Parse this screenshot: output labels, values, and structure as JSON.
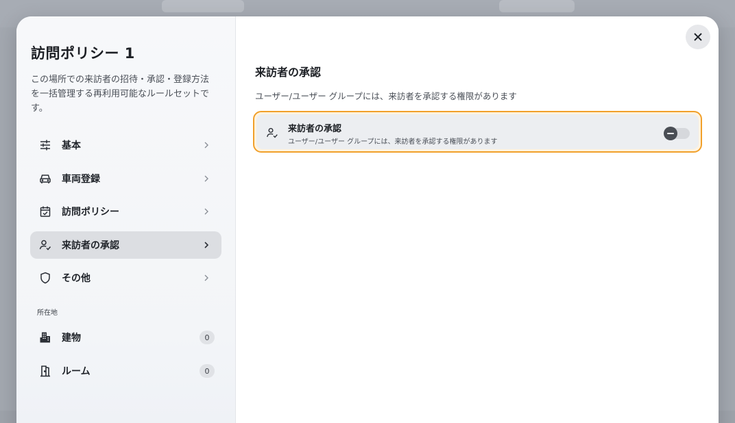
{
  "sidebar": {
    "title": "訪問ポリシー 1",
    "description": "この場所での来訪者の招待・承認・登録方法を一括管理する再利用可能なルールセットです。",
    "items": [
      {
        "label": "基本",
        "icon": "sliders-icon"
      },
      {
        "label": "車両登録",
        "icon": "car-icon"
      },
      {
        "label": "訪問ポリシー",
        "icon": "calendar-check-icon"
      },
      {
        "label": "来訪者の承認",
        "icon": "user-check-icon",
        "active": true
      },
      {
        "label": "その他",
        "icon": "shield-icon"
      }
    ],
    "section_label": "所在地",
    "locations": [
      {
        "label": "建物",
        "count": "0",
        "icon": "building-icon"
      },
      {
        "label": "ルーム",
        "count": "0",
        "icon": "door-icon"
      }
    ]
  },
  "content": {
    "title": "来訪者の承認",
    "description": "ユーザー/ユーザー グループには、来訪者を承認する権限があります",
    "setting": {
      "title": "来訪者の承認",
      "subtitle": "ユーザー/ユーザー グループには、来訪者を承認する権限があります",
      "enabled": false
    }
  },
  "colors": {
    "accent_border": "#f1a02a",
    "active_nav": "#dcdee2"
  }
}
